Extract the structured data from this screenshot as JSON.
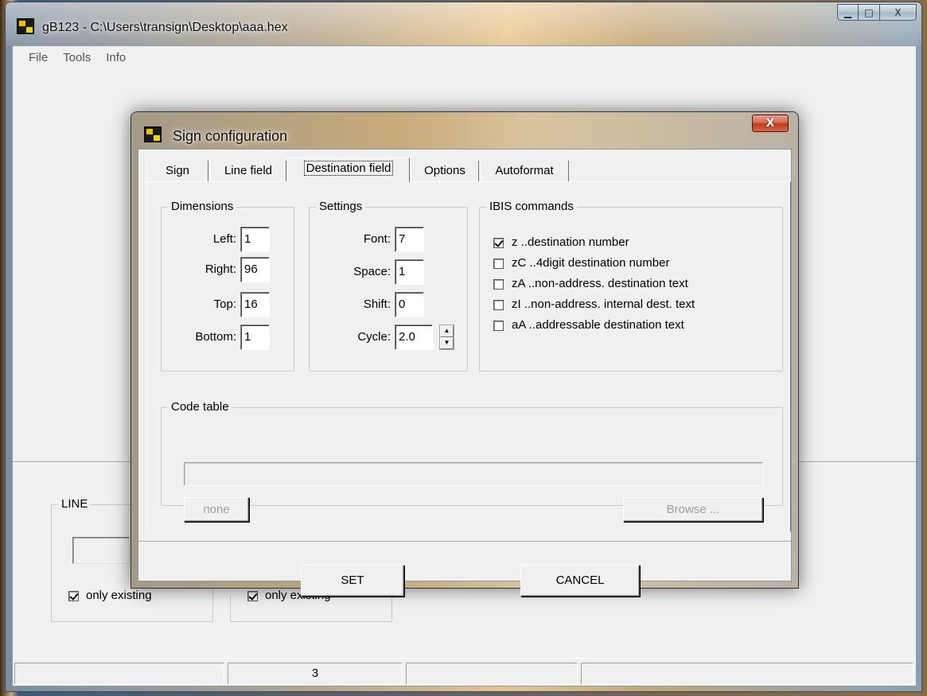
{
  "main_window": {
    "title": "gB123 - C:\\Users\\transign\\Desktop\\aaa.hex",
    "controls": {
      "minimize": "▁",
      "maximize": "□",
      "close": "X"
    },
    "menu": [
      "File",
      "Tools",
      "Info"
    ],
    "groups": {
      "line": {
        "legend": "LINE",
        "only_existing_label": "only existing",
        "only_existing_checked": true
      },
      "second": {
        "only_existing_label": "only existing",
        "only_existing_checked": true
      }
    },
    "statusbar": [
      "",
      "3",
      "",
      ""
    ]
  },
  "dialog": {
    "title": "Sign configuration",
    "close_label": "X",
    "tabs": [
      "Sign",
      "Line field",
      "Destination field",
      "Options",
      "Autoformat"
    ],
    "active_tab": "Destination field",
    "dimensions": {
      "legend": "Dimensions",
      "fields": [
        {
          "label": "Left:",
          "value": "1"
        },
        {
          "label": "Right:",
          "value": "96"
        },
        {
          "label": "Top:",
          "value": "16"
        },
        {
          "label": "Bottom:",
          "value": "1"
        }
      ]
    },
    "settings": {
      "legend": "Settings",
      "fields": [
        {
          "label": "Font:",
          "value": "7"
        },
        {
          "label": "Space:",
          "value": "1"
        },
        {
          "label": "Shift:",
          "value": "0"
        },
        {
          "label": "Cycle:",
          "value": "2.0"
        }
      ],
      "spin_up": "▲",
      "spin_down": "▼"
    },
    "ibis": {
      "legend": "IBIS commands",
      "items": [
        {
          "label": "z   ..destination number",
          "checked": true
        },
        {
          "label": "zC ..4digit destination number",
          "checked": false
        },
        {
          "label": "zA ..non-address. destination text",
          "checked": false
        },
        {
          "label": "zI  ..non-address. internal dest. text",
          "checked": false
        },
        {
          "label": "aA ..addressable destination text",
          "checked": false
        }
      ]
    },
    "code_table": {
      "legend": "Code table",
      "value": "",
      "none_label": "none",
      "browse_label": "Browse ..."
    },
    "set_label": "SET",
    "cancel_label": "CANCEL"
  }
}
